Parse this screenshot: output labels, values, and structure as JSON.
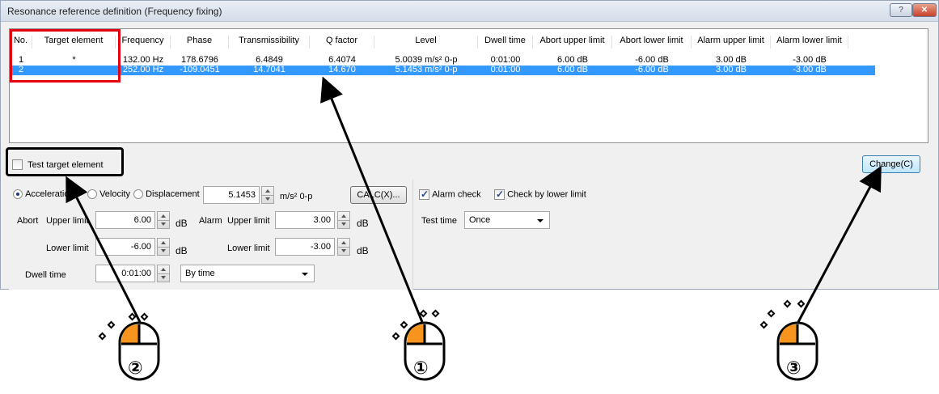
{
  "window": {
    "title": "Resonance reference definition (Frequency fixing)",
    "help_label": "?",
    "close_label": "✕"
  },
  "table": {
    "headers": [
      "No.",
      "Target element",
      "Frequency",
      "Phase",
      "Transmissibility",
      "Q factor",
      "Level",
      "Dwell time",
      "Abort upper limit",
      "Abort lower limit",
      "Alarm upper limit",
      "Alarm lower limit"
    ],
    "rows": [
      [
        "1",
        "*",
        "132.00 Hz",
        "178.6796",
        "6.4849",
        "6.4074",
        "5.0039 m/s² 0-p",
        "0:01:00",
        "6.00 dB",
        "-6.00 dB",
        "3.00 dB",
        "-3.00 dB"
      ],
      [
        "2",
        "",
        "252.00 Hz",
        "-109.0451",
        "14.7041",
        "14.670",
        "5.1453 m/s² 0-p",
        "0:01:00",
        "6.00 dB",
        "-6.00 dB",
        "3.00 dB",
        "-3.00 dB"
      ]
    ],
    "selected_row": 2
  },
  "controls": {
    "test_target_label": "Test target element",
    "change_button": "Change(C)",
    "radio_acceleration": "Acceleration",
    "radio_velocity": "Velocity",
    "radio_displacement": "Displacement",
    "level_value": "5.1453",
    "level_unit": "m/s² 0-p",
    "calc_button": "CALC(X)...",
    "alarm_check_label": "Alarm check",
    "check_lower_label": "Check by lower limit",
    "abort_label": "Abort",
    "upper_limit_label": "Upper limit",
    "lower_limit_label": "Lower limit",
    "alarm_label": "Alarm",
    "abort_upper_value": "6.00",
    "abort_lower_value": "-6.00",
    "alarm_upper_value": "3.00",
    "alarm_lower_value": "-3.00",
    "db_unit": "dB",
    "test_time_label": "Test time",
    "test_time_value": "Once",
    "dwell_time_label": "Dwell time",
    "dwell_time_value": "0:01:00",
    "dwell_mode_value": "By time"
  },
  "annotations": {
    "step1": "①",
    "step2": "②",
    "step3": "③",
    "mouse_color": "#f7941d",
    "highlight_red": "#e4000f"
  }
}
